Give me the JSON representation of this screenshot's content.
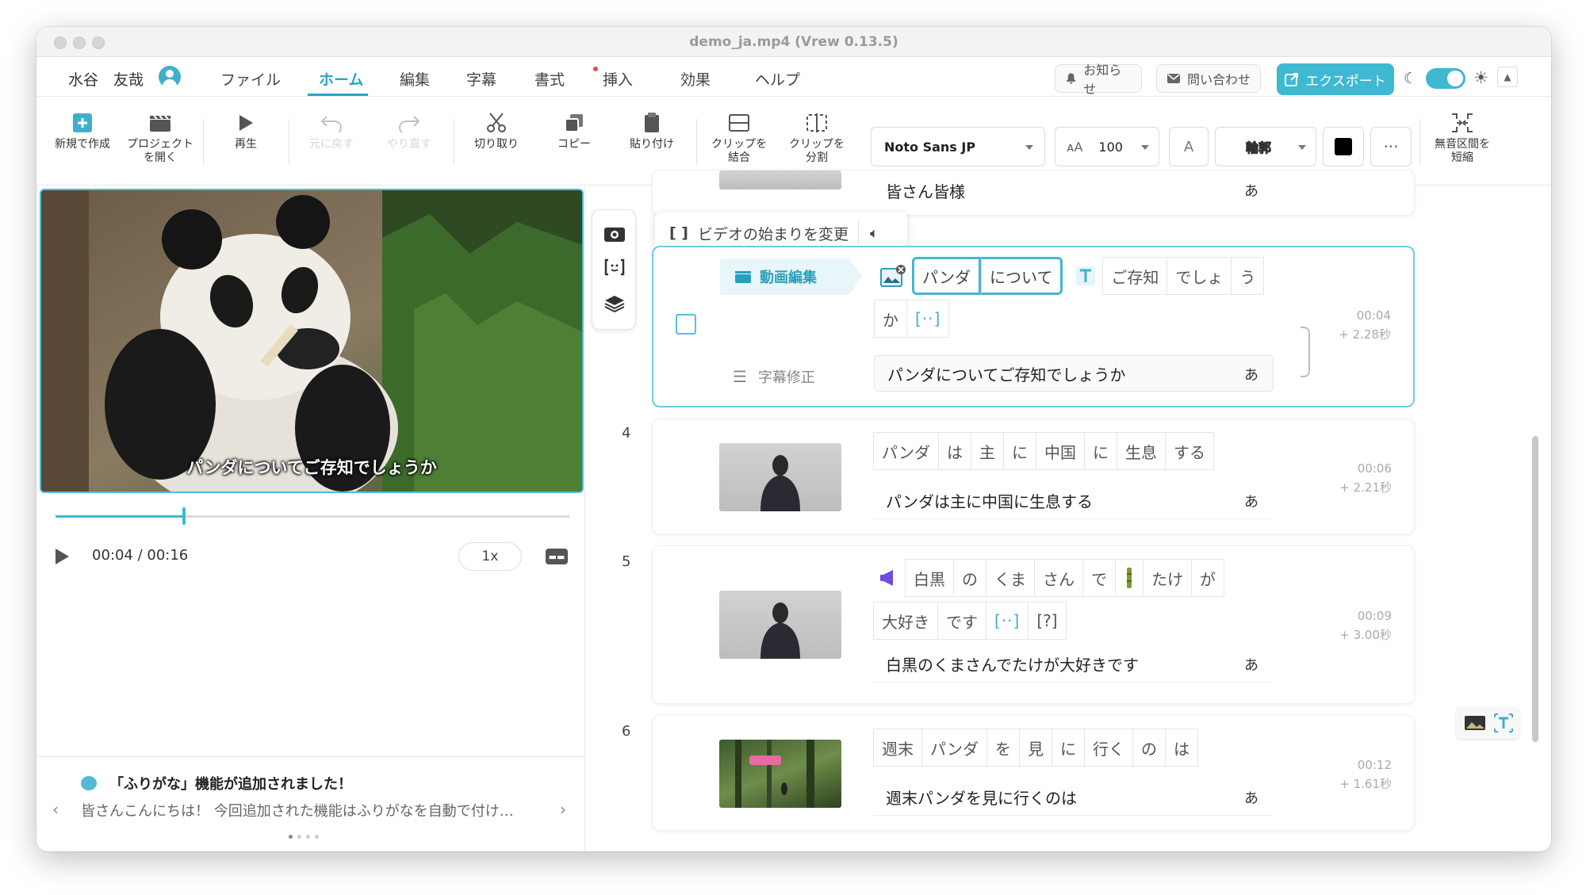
{
  "window": {
    "title": "demo_ja.mp4 (Vrew 0.13.5)"
  },
  "menubar": {
    "username": "水谷　友哉",
    "tabs": [
      "ファイル",
      "ホーム",
      "編集",
      "字幕",
      "書式",
      "挿入",
      "効果",
      "ヘルプ"
    ],
    "active_tab": "ホーム",
    "notice": "お知らせ",
    "contact": "問い合わせ",
    "export": "エクスポート"
  },
  "toolbar": {
    "new": "新規で作成",
    "open_1": "プロジェクト",
    "open_2": "を開く",
    "play": "再生",
    "undo": "元に戻す",
    "redo": "やり直す",
    "cut": "切り取り",
    "copy": "コピー",
    "paste": "貼り付け",
    "merge_1": "クリップを",
    "merge_2": "結合",
    "split_1": "クリップを",
    "split_2": "分割",
    "font": "Noto Sans JP",
    "font_size": "100",
    "outline": "輪郭",
    "shorten_1": "無音区間を",
    "shorten_2": "短縮"
  },
  "player": {
    "overlay_subtitle": "パンダについてご存知でしょうか",
    "time": "00:04 / 00:16",
    "speed": "1x",
    "progress_fraction": 0.25
  },
  "news": {
    "title": "「ふりがな」機能が追加されました！",
    "body": "皆さんこんにちは！ 今回追加された機能はふりがなを自動で付け…"
  },
  "tooltip": {
    "text": "ビデオの始まりを変更"
  },
  "clips": {
    "c2": {
      "subtitle": "皆さん皆様",
      "kana": "あ"
    },
    "c3": {
      "tag": "動画編集",
      "subfix": "字幕修正",
      "words_row1": [
        "パンダ",
        "について",
        "ご存知",
        "でしょ",
        "う"
      ],
      "words_row2": [
        "か",
        "[··]"
      ],
      "subtitle": "パンダについてご存知でしょうか",
      "time": "00:04",
      "dur": "+ 2.28秒",
      "kana": "あ"
    },
    "c4": {
      "num": "4",
      "words": [
        "パンダ",
        "は",
        "主",
        "に",
        "中国",
        "に",
        "生息",
        "する"
      ],
      "subtitle": "パンダは主に中国に生息する",
      "time": "00:06",
      "dur": "+ 2.21秒",
      "kana": "あ"
    },
    "c5": {
      "num": "5",
      "words_row1": [
        "白黒",
        "の",
        "くま",
        "さん",
        "で",
        "たけ",
        "が"
      ],
      "words_row2": [
        "大好き",
        "です",
        "[··]",
        "[?]"
      ],
      "subtitle": "白黒のくまさんでたけが大好きです",
      "time": "00:09",
      "dur": "+ 3.00秒",
      "kana": "あ"
    },
    "c6": {
      "num": "6",
      "words": [
        "週末",
        "パンダ",
        "を",
        "見",
        "に",
        "行く",
        "の",
        "は"
      ],
      "subtitle": "週末パンダを見に行くのは",
      "time": "00:12",
      "dur": "+ 1.61秒",
      "kana": "あ"
    }
  },
  "colors": {
    "accent": "#3fb8d2",
    "selection": "#43b6d0",
    "tag_bg": "#e8f6fa",
    "menu_active": "#2aa6c4"
  }
}
